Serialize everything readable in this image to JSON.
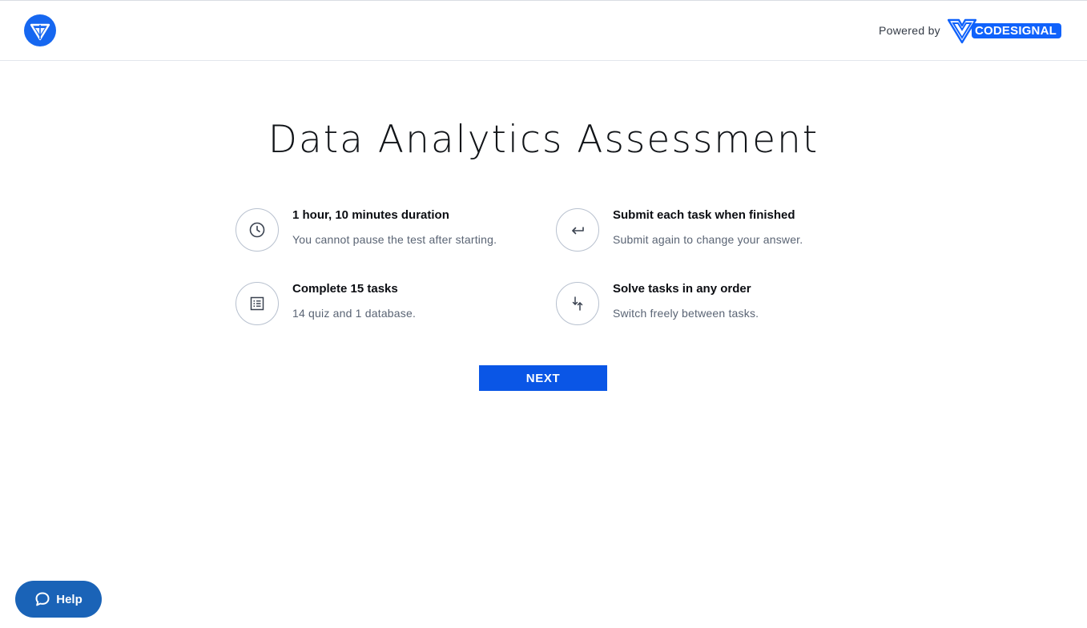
{
  "header": {
    "brand_logo_icon": "brand-shield-logo",
    "powered_by": "Powered by",
    "codesignal_label": "CODESIGNAL"
  },
  "main": {
    "title": "Data Analytics Assessment",
    "features": [
      {
        "icon": "clock-icon",
        "title": "1 hour, 10 minutes duration",
        "description": "You cannot pause the test after starting."
      },
      {
        "icon": "return-arrow-icon",
        "title": "Submit each task when finished",
        "description": "Submit again to change your answer."
      },
      {
        "icon": "task-list-icon",
        "title": "Complete 15 tasks",
        "description": "14 quiz and 1 database."
      },
      {
        "icon": "reorder-arrows-icon",
        "title": "Solve tasks in any order",
        "description": "Switch freely between tasks."
      }
    ],
    "next_label": "NEXT"
  },
  "help": {
    "label": "Help",
    "icon": "chat-bubble-icon"
  },
  "colors": {
    "primary": "#0a56e6",
    "brand_blue": "#1062fb",
    "help_blue": "#1a63b7",
    "icon_border": "#b8c1cf",
    "muted_text": "#5a6474"
  }
}
